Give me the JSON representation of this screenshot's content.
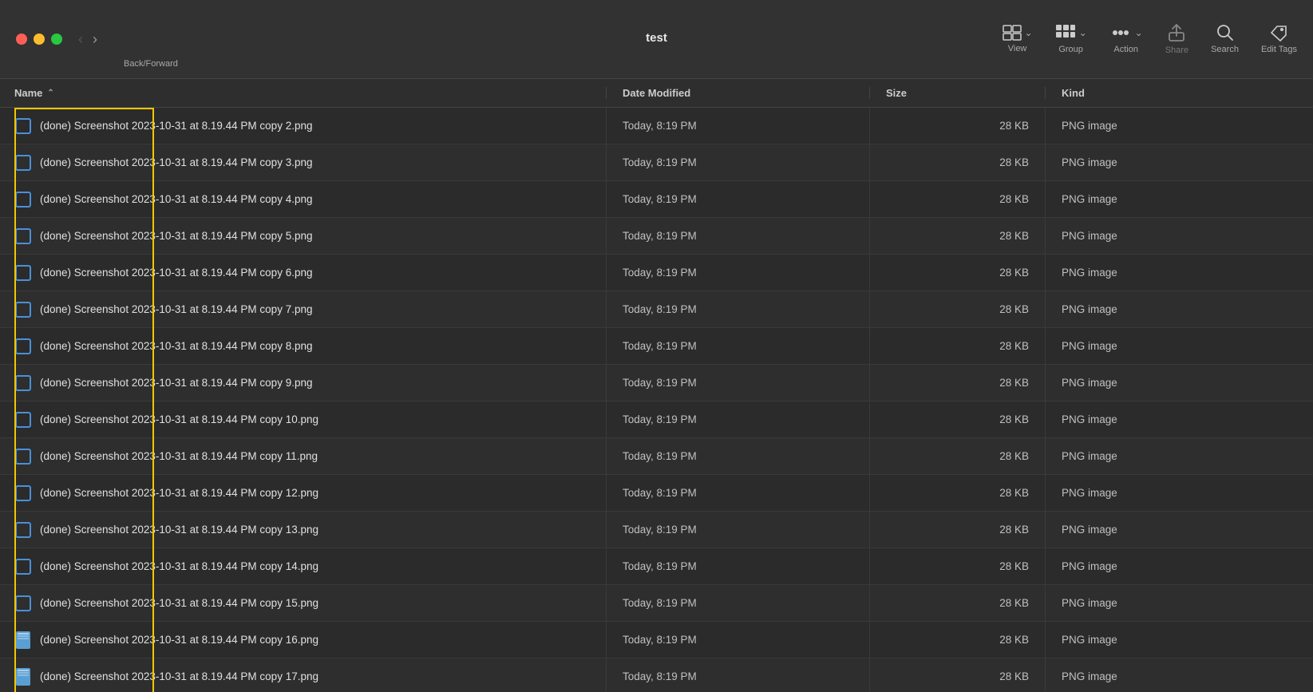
{
  "window": {
    "title": "test"
  },
  "toolbar": {
    "back_forward_label": "Back/Forward",
    "view_label": "View",
    "group_label": "Group",
    "action_label": "Action",
    "share_label": "Share",
    "search_label": "Search",
    "edit_tags_label": "Edit Tags"
  },
  "columns": {
    "name": "Name",
    "date_modified": "Date Modified",
    "size": "Size",
    "kind": "Kind"
  },
  "files": [
    {
      "name": "(done) Screenshot 2023-10-31 at 8.19.44 PM copy 2.png",
      "date": "Today, 8:19 PM",
      "size": "28 KB",
      "kind": "PNG image",
      "icon": "checkbox"
    },
    {
      "name": "(done) Screenshot 2023-10-31 at 8.19.44 PM copy 3.png",
      "date": "Today, 8:19 PM",
      "size": "28 KB",
      "kind": "PNG image",
      "icon": "checkbox"
    },
    {
      "name": "(done) Screenshot 2023-10-31 at 8.19.44 PM copy 4.png",
      "date": "Today, 8:19 PM",
      "size": "28 KB",
      "kind": "PNG image",
      "icon": "checkbox"
    },
    {
      "name": "(done) Screenshot 2023-10-31 at 8.19.44 PM copy 5.png",
      "date": "Today, 8:19 PM",
      "size": "28 KB",
      "kind": "PNG image",
      "icon": "checkbox"
    },
    {
      "name": "(done) Screenshot 2023-10-31 at 8.19.44 PM copy 6.png",
      "date": "Today, 8:19 PM",
      "size": "28 KB",
      "kind": "PNG image",
      "icon": "checkbox"
    },
    {
      "name": "(done) Screenshot 2023-10-31 at 8.19.44 PM copy 7.png",
      "date": "Today, 8:19 PM",
      "size": "28 KB",
      "kind": "PNG image",
      "icon": "checkbox"
    },
    {
      "name": "(done) Screenshot 2023-10-31 at 8.19.44 PM copy 8.png",
      "date": "Today, 8:19 PM",
      "size": "28 KB",
      "kind": "PNG image",
      "icon": "checkbox"
    },
    {
      "name": "(done) Screenshot 2023-10-31 at 8.19.44 PM copy 9.png",
      "date": "Today, 8:19 PM",
      "size": "28 KB",
      "kind": "PNG image",
      "icon": "checkbox"
    },
    {
      "name": "(done) Screenshot 2023-10-31 at 8.19.44 PM copy 10.png",
      "date": "Today, 8:19 PM",
      "size": "28 KB",
      "kind": "PNG image",
      "icon": "checkbox"
    },
    {
      "name": "(done) Screenshot 2023-10-31 at 8.19.44 PM copy 11.png",
      "date": "Today, 8:19 PM",
      "size": "28 KB",
      "kind": "PNG image",
      "icon": "checkbox"
    },
    {
      "name": "(done) Screenshot 2023-10-31 at 8.19.44 PM copy 12.png",
      "date": "Today, 8:19 PM",
      "size": "28 KB",
      "kind": "PNG image",
      "icon": "checkbox"
    },
    {
      "name": "(done) Screenshot 2023-10-31 at 8.19.44 PM copy 13.png",
      "date": "Today, 8:19 PM",
      "size": "28 KB",
      "kind": "PNG image",
      "icon": "checkbox"
    },
    {
      "name": "(done) Screenshot 2023-10-31 at 8.19.44 PM copy 14.png",
      "date": "Today, 8:19 PM",
      "size": "28 KB",
      "kind": "PNG image",
      "icon": "checkbox"
    },
    {
      "name": "(done) Screenshot 2023-10-31 at 8.19.44 PM copy 15.png",
      "date": "Today, 8:19 PM",
      "size": "28 KB",
      "kind": "PNG image",
      "icon": "checkbox"
    },
    {
      "name": "(done) Screenshot 2023-10-31 at 8.19.44 PM copy 16.png",
      "date": "Today, 8:19 PM",
      "size": "28 KB",
      "kind": "PNG image",
      "icon": "file"
    },
    {
      "name": "(done) Screenshot 2023-10-31 at 8.19.44 PM copy 17.png",
      "date": "Today, 8:19 PM",
      "size": "28 KB",
      "kind": "PNG image",
      "icon": "file"
    }
  ]
}
